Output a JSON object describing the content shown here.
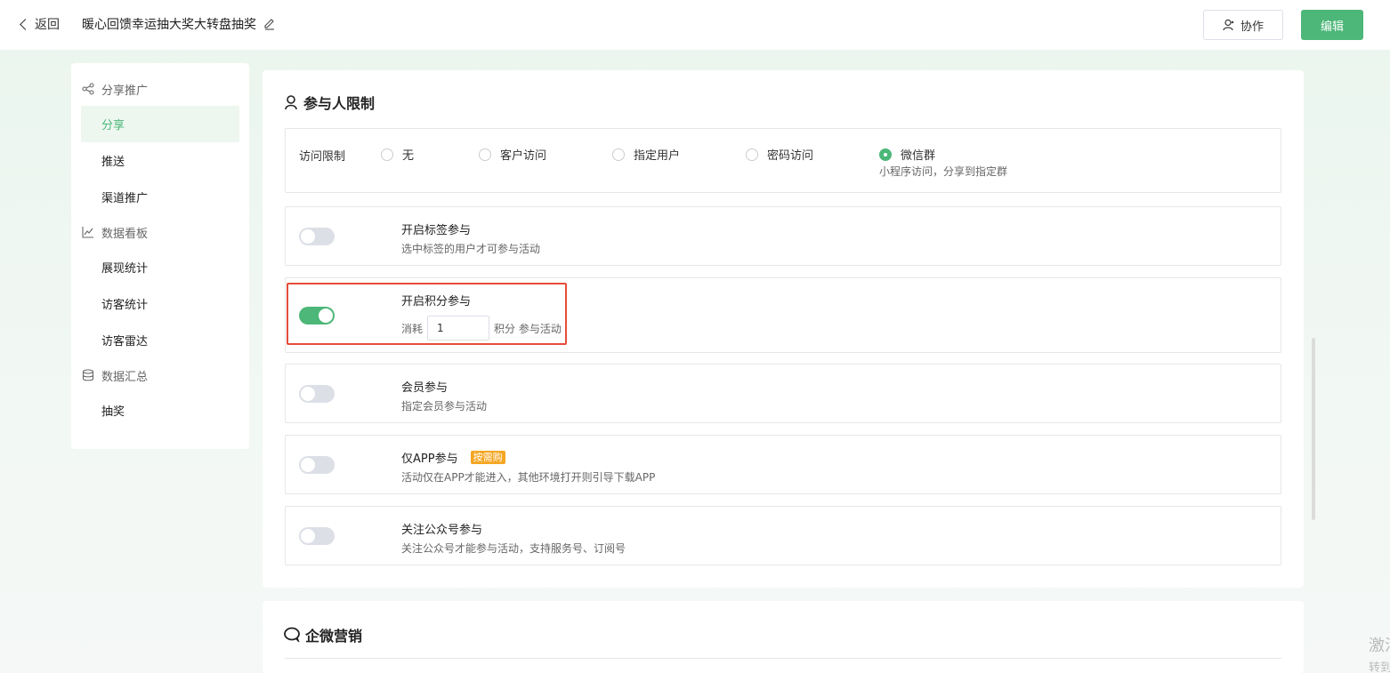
{
  "header": {
    "back_label": "返回",
    "title": "暖心回馈幸运抽大奖大转盘抽奖",
    "collab_label": "协作",
    "edit_label": "编辑"
  },
  "sidebar": {
    "groups": [
      {
        "label": "分享推广",
        "icon": "share-icon",
        "items": [
          "分享",
          "推送",
          "渠道推广"
        ]
      },
      {
        "label": "数据看板",
        "icon": "chart-icon",
        "items": [
          "展现统计",
          "访客统计",
          "访客雷达"
        ]
      },
      {
        "label": "数据汇总",
        "icon": "database-icon",
        "items": [
          "抽奖"
        ]
      }
    ],
    "active_item": "分享"
  },
  "participant": {
    "title": "参与人限制",
    "access": {
      "label": "访问限制",
      "options": [
        "无",
        "客户访问",
        "指定用户",
        "密码访问",
        "微信群"
      ],
      "selected": "微信群",
      "selected_desc": "小程序访问，分享到指定群"
    },
    "tag": {
      "title": "开启标签参与",
      "desc": "选中标签的用户才可参与活动",
      "enabled": false
    },
    "points": {
      "title": "开启积分参与",
      "prefix": "消耗",
      "value": "1",
      "suffix": "积分 参与活动",
      "enabled": true
    },
    "member": {
      "title": "会员参与",
      "desc": "指定会员参与活动",
      "enabled": false
    },
    "app": {
      "title": "仅APP参与",
      "badge": "按需购",
      "desc": "活动仅在APP才能进入，其他环境打开则引导下载APP",
      "enabled": false
    },
    "official": {
      "title": "关注公众号参与",
      "desc": "关注公众号才能参与活动，支持服务号、订阅号",
      "enabled": false
    }
  },
  "wecom": {
    "title": "企微营销"
  },
  "watermark": {
    "line1": "激活 Windows",
    "line2": "转到设置以激活 Windows。"
  },
  "colors": {
    "accent": "#4cb778",
    "badge": "#f5a623",
    "highlight": "#e74c3c"
  }
}
